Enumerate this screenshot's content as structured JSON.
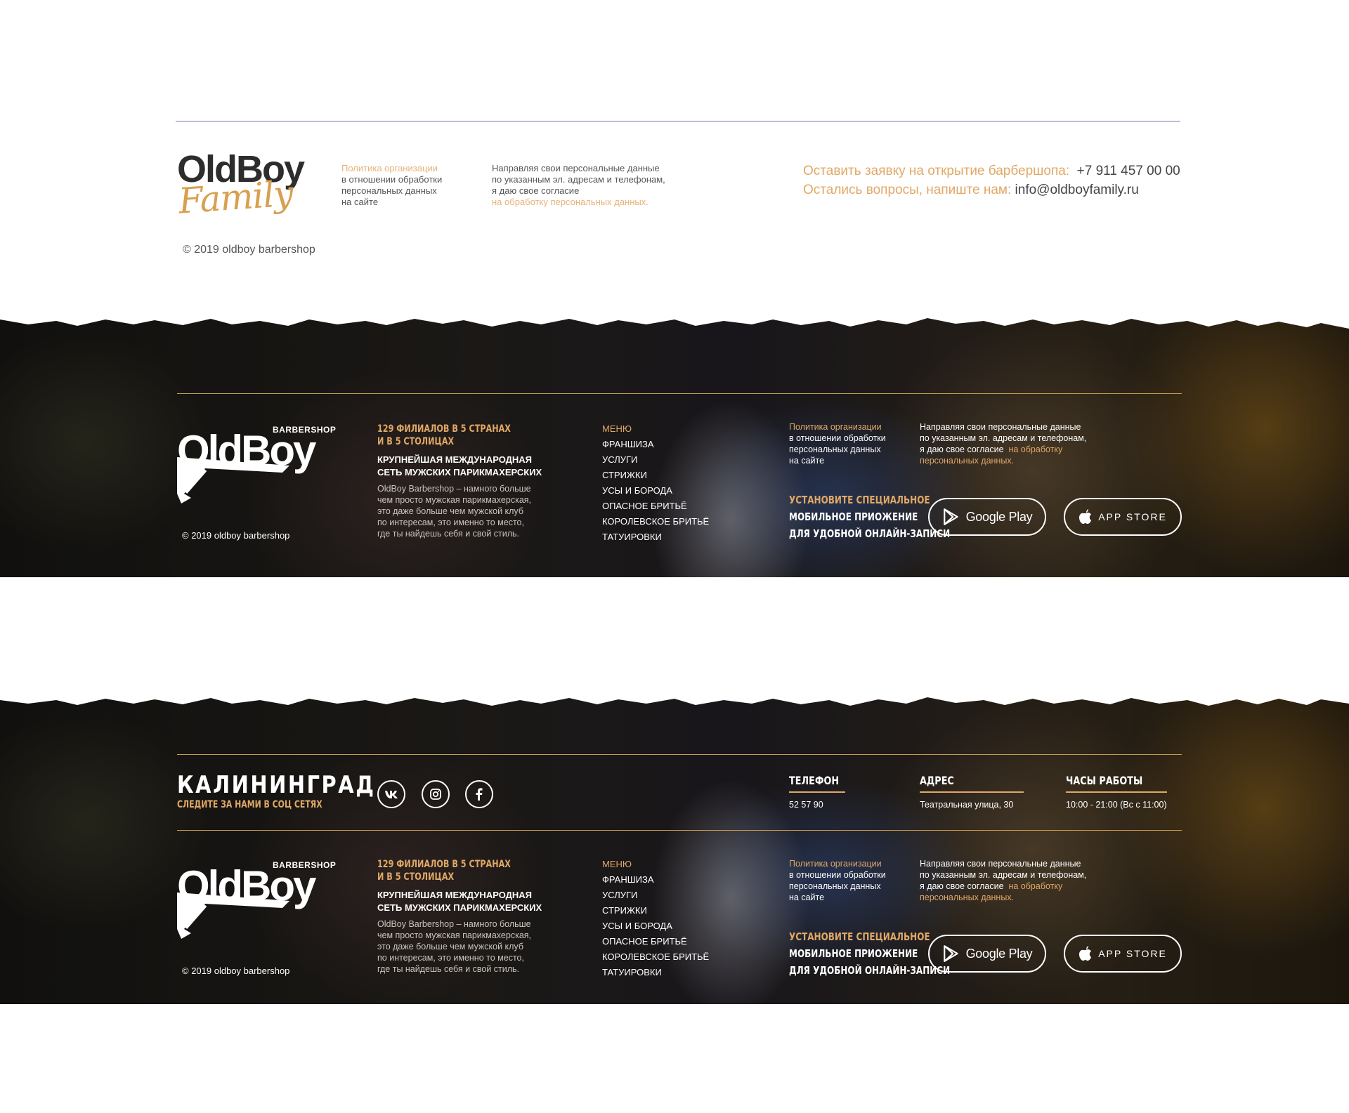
{
  "light": {
    "logo_word1": "OldBoy",
    "logo_word2": "Family",
    "policy_link": "Политика организации",
    "policy_lines": [
      "в отношении обработки",
      "персональных данных",
      "на сайте"
    ],
    "consent_lines": [
      "Направляя свои персональные данные",
      "по указанным эл. адресам и телефонам,",
      "я даю свое согласие"
    ],
    "consent_link": "на обработку персональных данных.",
    "contact_request_label": "Оставить заявку на открытие барбершопа:",
    "contact_request_value": "+7 911 457 00 00",
    "contact_question_label": "Остались вопросы, напиште нам:",
    "contact_question_value": "info@oldboyfamily.ru",
    "copyright": "© 2019 oldboy barbershop"
  },
  "dark": {
    "logo_word": "OldBoy",
    "logo_tag": "BARBERSHOP",
    "copyright": "© 2019 oldboy barbershop",
    "promo_heading_lines": [
      "129 филиалов в 5 странах",
      "и в 5 столицах"
    ],
    "promo_sub_lines": [
      "Крупнейшая международная",
      "сеть мужских парикмахерских"
    ],
    "promo_desc_lines": [
      "OldBoy Barbershop – намного больше",
      "чем просто мужская парикмахерская,",
      "это даже больше чем мужской клуб",
      "по интересам, это именно то место,",
      "где ты найдешь себя и свой стиль."
    ],
    "menu": [
      "Меню",
      "Франшиза",
      "Услуги",
      "Стрижки",
      "Усы и борода",
      "Опасное бритьё",
      "Королевское бритьё",
      "Татуировки"
    ],
    "policy_link": "Политика организации",
    "policy_lines": [
      "в отношении обработки",
      "персональных данных",
      "на сайте"
    ],
    "consent_lines": [
      "Направляя свои персональные данные",
      "по указанным эл. адресам и телефонам,",
      "я даю свое согласие"
    ],
    "consent_link_1": "на обработку",
    "consent_link_2": "персональных данных.",
    "install_lines": [
      "Установите специальное",
      "мобильное приожение",
      "для удобной онлайн-записи"
    ],
    "google_play": "Google Play",
    "app_store": "APP STORE"
  },
  "city_row": {
    "city": "КАЛИНИНГРАД",
    "follow": "Следите за нами в соц сетях",
    "social": [
      "vk-icon",
      "instagram-icon",
      "facebook-icon"
    ],
    "phone_title": "Телефон",
    "phone_value": "52 57 90",
    "address_title": "Адрес",
    "address_value": "Театральная улица, 30",
    "hours_title": "Часы работы",
    "hours_value": "10:00 - 21:00 (Вс с 11:00)"
  },
  "colors": {
    "accent_gold": "#e0a866",
    "rule_gold": "#c79a4e",
    "rule_blue": "#6f74b8",
    "text_dark": "#333333"
  }
}
